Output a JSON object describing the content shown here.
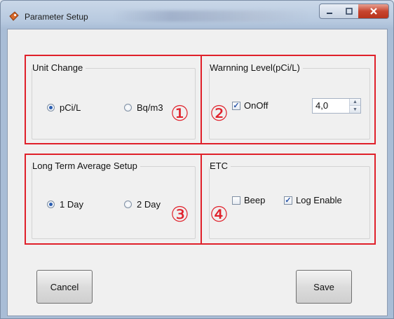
{
  "window": {
    "title": "Parameter Setup",
    "controls": {
      "minimize": "–",
      "maximize": "□",
      "close": "X"
    }
  },
  "annotations": [
    "①",
    "②",
    "③",
    "④"
  ],
  "unit_change": {
    "label": "Unit Change",
    "options": [
      {
        "label": "pCi/L",
        "selected": true
      },
      {
        "label": "Bq/m3",
        "selected": false
      }
    ]
  },
  "warning_level": {
    "label": "Warnning Level(pCi/L)",
    "onoff_label": "OnOff",
    "onoff_checked": true,
    "value": "4,0"
  },
  "long_term": {
    "label": "Long Term Average Setup",
    "options": [
      {
        "label": "1 Day",
        "selected": true
      },
      {
        "label": "2 Day",
        "selected": false
      }
    ]
  },
  "etc": {
    "label": "ETC",
    "beep_label": "Beep",
    "beep_checked": false,
    "log_label": "Log Enable",
    "log_checked": true
  },
  "buttons": {
    "cancel": "Cancel",
    "save": "Save"
  },
  "colors": {
    "annotation_red": "#e0202a",
    "radio_accent": "#2a5db0"
  }
}
